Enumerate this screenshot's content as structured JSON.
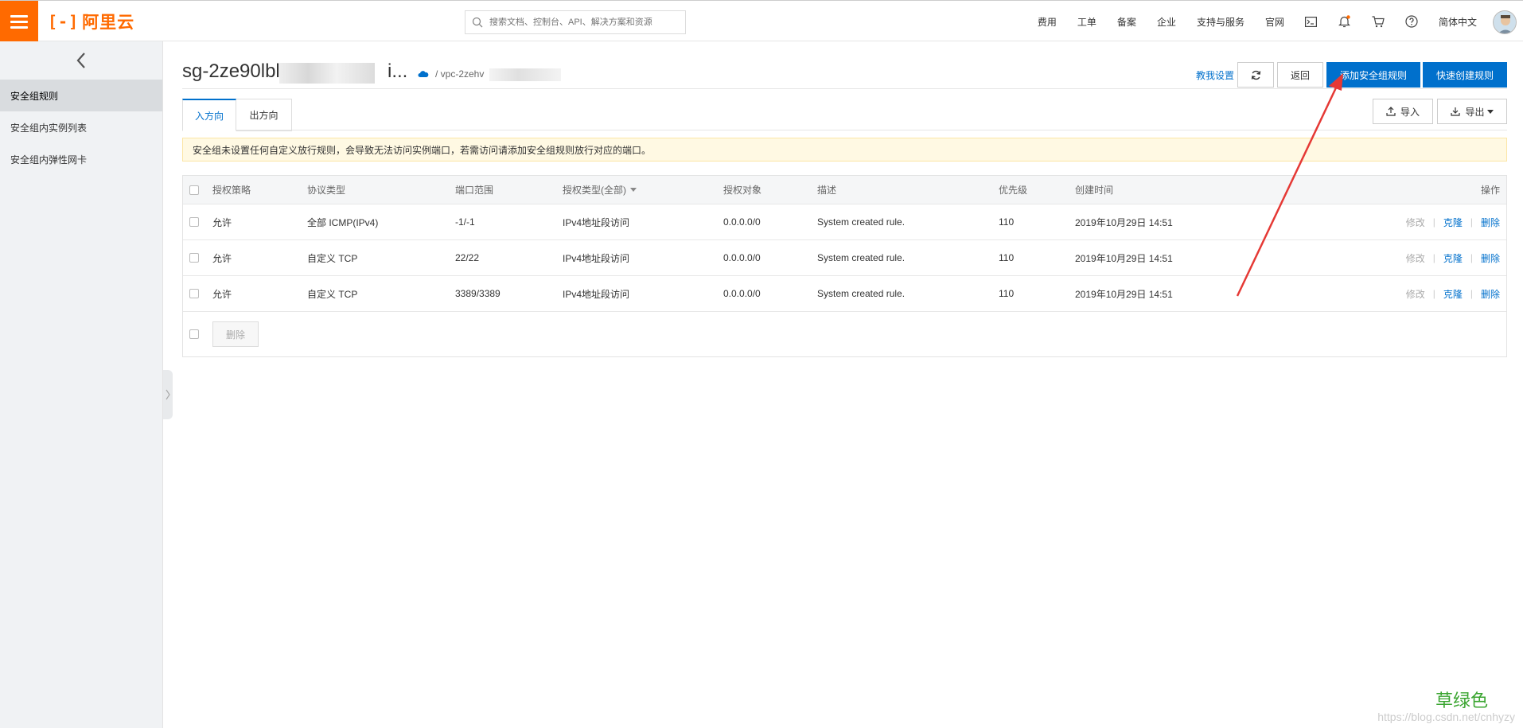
{
  "topbar": {
    "logo_text": "阿里云",
    "search_placeholder": "搜索文档、控制台、API、解决方案和资源",
    "nav": [
      "费用",
      "工单",
      "备案",
      "企业",
      "支持与服务",
      "官网"
    ],
    "lang": "简体中文"
  },
  "sidebar": {
    "items": [
      "安全组规则",
      "安全组内实例列表",
      "安全组内弹性网卡"
    ],
    "active_index": 0
  },
  "header": {
    "title_prefix": "sg-2ze90lblk",
    "title_suffix": "i...",
    "vpc_label": "/ vpc-2zehv",
    "teach_link": "教我设置",
    "back_button": "返回",
    "add_rule_button": "添加安全组规则",
    "quick_create_button": "快速创建规则"
  },
  "tabs": {
    "inbound": "入方向",
    "outbound": "出方向"
  },
  "toolbar": {
    "import": "导入",
    "export": "导出"
  },
  "notice": "安全组未设置任何自定义放行规则，会导致无法访问实例端口，若需访问请添加安全组规则放行对应的端口。",
  "table": {
    "headers": {
      "policy": "授权策略",
      "protocol": "协议类型",
      "port": "端口范围",
      "auth_type": "授权类型(全部)",
      "target": "授权对象",
      "desc": "描述",
      "priority": "优先级",
      "created": "创建时间",
      "ops": "操作"
    },
    "rows": [
      {
        "policy": "允许",
        "protocol": "全部 ICMP(IPv4)",
        "port": "-1/-1",
        "auth_type": "IPv4地址段访问",
        "target": "0.0.0.0/0",
        "desc": "System created rule.",
        "priority": "110",
        "created": "2019年10月29日 14:51"
      },
      {
        "policy": "允许",
        "protocol": "自定义 TCP",
        "port": "22/22",
        "auth_type": "IPv4地址段访问",
        "target": "0.0.0.0/0",
        "desc": "System created rule.",
        "priority": "110",
        "created": "2019年10月29日 14:51"
      },
      {
        "policy": "允许",
        "protocol": "自定义 TCP",
        "port": "3389/3389",
        "auth_type": "IPv4地址段访问",
        "target": "0.0.0.0/0",
        "desc": "System created rule.",
        "priority": "110",
        "created": "2019年10月29日 14:51"
      }
    ],
    "row_ops": {
      "edit": "修改",
      "clone": "克隆",
      "delete": "删除"
    },
    "bulk_delete": "删除"
  },
  "watermark": {
    "text": "草绿色",
    "url": "https://blog.csdn.net/cnhyzy"
  },
  "colors": {
    "brand": "#ff6a00",
    "primary": "#0070cc",
    "arrow": "#e53935"
  }
}
